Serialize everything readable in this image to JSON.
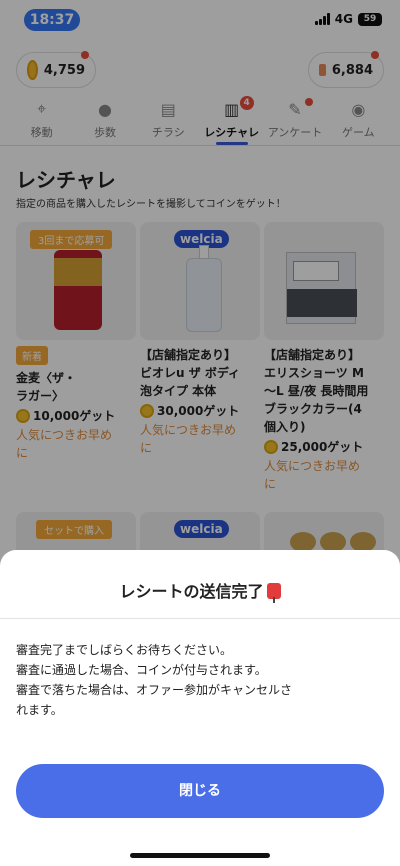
{
  "status": {
    "time": "18:37",
    "network": "4G",
    "battery": "59"
  },
  "header": {
    "medal_coins": "4,759",
    "ticket_coins": "6,884"
  },
  "tabs": [
    {
      "label": "移動",
      "icon": "map-pin-icon"
    },
    {
      "label": "歩数",
      "icon": "footsteps-icon"
    },
    {
      "label": "チラシ",
      "icon": "flyer-icon"
    },
    {
      "label": "レシチャレ",
      "icon": "receipt-icon",
      "badge": "4",
      "active": true
    },
    {
      "label": "アンケート",
      "icon": "pencil-icon"
    },
    {
      "label": "ゲーム",
      "icon": "gamepad-icon"
    }
  ],
  "page": {
    "title": "レシチャレ",
    "subtitle": "指定の商品を購入したレシートを撮影してコインをゲット！"
  },
  "cards": [
    {
      "ribbon": "3回まで応募可",
      "tag": "新着",
      "title_l1": "金麦〈ザ・",
      "title_l2": "ラガー〉",
      "price": "10,000ゲット",
      "note_l1": "人気につきお早め",
      "note_l2": "に"
    },
    {
      "store": "welcia",
      "title_l1": "【店舗指定あり】",
      "title_l2": "ビオレu ザ ボディ",
      "title_l3": "泡タイプ 本体",
      "price": "30,000ゲット",
      "note_l1": "人気につきお早め",
      "note_l2": "に"
    },
    {
      "title_l1": "【店舗指定あり】",
      "title_l2": "エリスショーツ M",
      "title_l3": "〜L 昼/夜 長時間用",
      "title_l4": "ブラックカラー(4",
      "title_l5": "個入り)",
      "price": "25,000ゲット",
      "note_l1": "人気につきお早め",
      "note_l2": "に"
    }
  ],
  "row2": {
    "ribbon": "セットで購入",
    "store": "welcia"
  },
  "sheet": {
    "title": "レシートの送信完了",
    "line1": "審査完了までしばらくお待ちください。",
    "line2": "審査に通過した場合、コインが付与されます。",
    "line3": "審査で落ちた場合は、オファー参加がキャンセルさ",
    "line4": "れます。",
    "close_label": "閉じる"
  }
}
